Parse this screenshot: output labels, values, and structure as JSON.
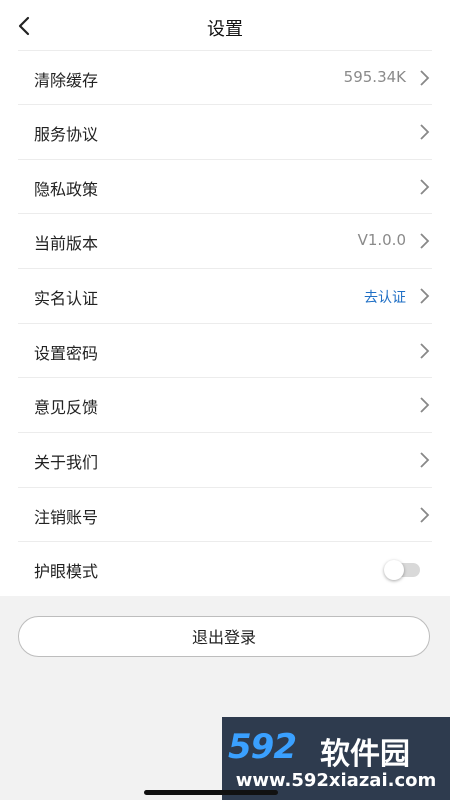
{
  "header": {
    "title": "设置"
  },
  "rows": [
    {
      "label": "清除缓存",
      "value": "595.34K"
    },
    {
      "label": "服务协议"
    },
    {
      "label": "隐私政策"
    },
    {
      "label": "当前版本",
      "value": "V1.0.0"
    },
    {
      "label": "实名认证",
      "value": "去认证"
    },
    {
      "label": "设置密码"
    },
    {
      "label": "意见反馈"
    },
    {
      "label": "关于我们"
    },
    {
      "label": "注销账号"
    },
    {
      "label": "护眼模式",
      "toggle_on": false
    }
  ],
  "logout": {
    "label": "退出登录"
  },
  "watermark": {
    "logo": "592",
    "brand": "软件园",
    "url": "www.592xiazai.com"
  },
  "colors": {
    "link": "#1f6fc5",
    "text": "#222222",
    "muted": "#8a8a8a",
    "background": "#f2f2f2"
  }
}
